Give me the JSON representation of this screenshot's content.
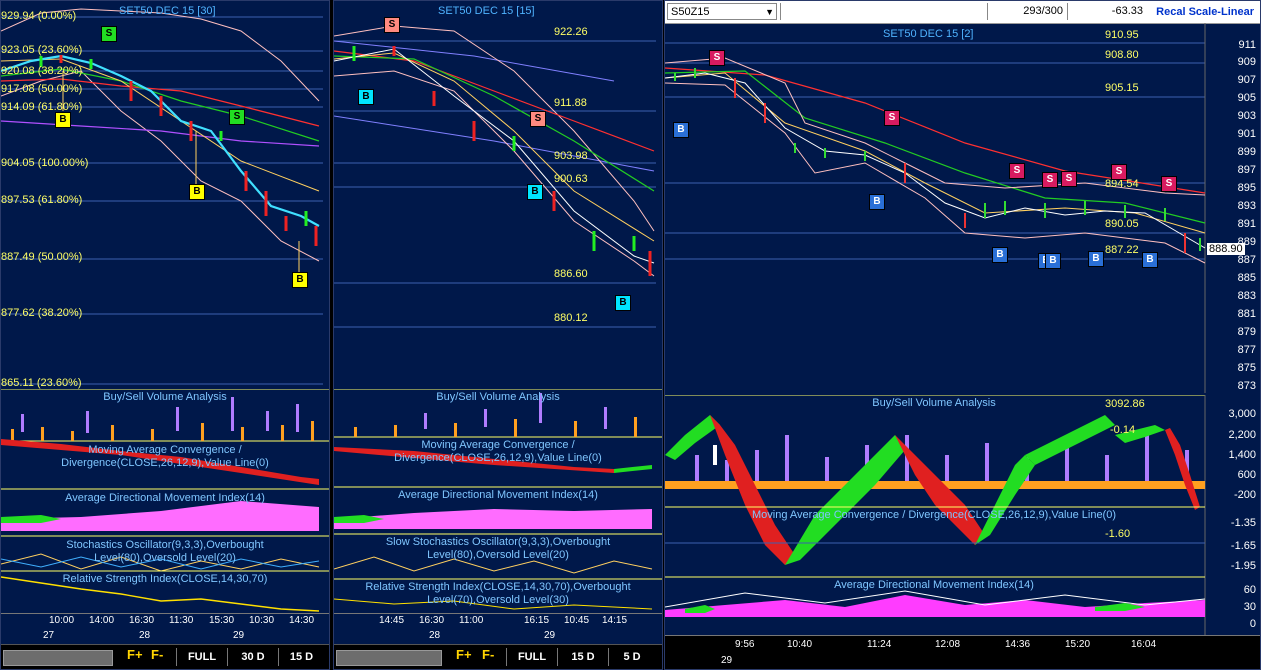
{
  "panel1": {
    "title": "SET50 DEC 15   [30]",
    "levels": [
      "929.94 (0.00%)",
      "923.05 (23.60%)",
      "920.08 (38.20%)",
      "917.08 (50.00%)",
      "914.09 (61.80%)",
      "904.05 (100.00%)",
      "897.53 (61.80%)",
      "887.49 (50.00%)",
      "877.62 (38.20%)",
      "865.11 (23.60%)"
    ],
    "indicators": [
      "Buy/Sell Volume Analysis",
      "Moving Average Convergence / Divergence(CLOSE,26,12,9),Value Line(0)",
      "Average Directional Movement Index(14)",
      "Stochastics Oscillator(9,3,3),Overbought Level(80),Oversold Level(20)",
      "Relative Strength Index(CLOSE,14,30,70)"
    ],
    "times": [
      "10:00",
      "14:00",
      "16:30",
      "11:30",
      "15:30",
      "10:30",
      "14:30"
    ],
    "dates": [
      "27",
      "28",
      "29"
    ],
    "buttons": [
      "FULL",
      "30 D",
      "15 D"
    ]
  },
  "panel2": {
    "title": "SET50 DEC 15   [15]",
    "levels": [
      "922.26",
      "911.88",
      "903.98",
      "900.63",
      "886.60",
      "880.12"
    ],
    "indicators": [
      "Buy/Sell Volume Analysis",
      "Moving Average Convergence / Divergence(CLOSE,26,12,9),Value Line(0)",
      "Average Directional Movement Index(14)",
      "Slow Stochastics Oscillator(9,3,3),Overbought Level(80),Oversold Level(20)",
      "Relative Strength Index(CLOSE,14,30,70),Overbought Level(70),Oversold Level(30)"
    ],
    "times": [
      "14:45",
      "16:30",
      "11:00",
      "16:15",
      "10:45",
      "14:15"
    ],
    "dates": [
      "28",
      "29"
    ],
    "buttons": [
      "FULL",
      "15 D",
      "5 D"
    ]
  },
  "panel3": {
    "symbol": "S50Z15",
    "count": "293/300",
    "change": "-63.33",
    "recal": "Recal Scale-Linear",
    "title": "SET50 DEC 15   [2]",
    "levels": [
      "910.95",
      "908.80",
      "905.15",
      "894.54",
      "890.05",
      "887.22"
    ],
    "last_price": "888.90",
    "yaxis": [
      "911",
      "909",
      "907",
      "905",
      "903",
      "901",
      "899",
      "897",
      "895",
      "893",
      "891",
      "889",
      "887",
      "885",
      "883",
      "881",
      "879",
      "877",
      "875",
      "873"
    ],
    "vol_value": "3092.86",
    "vol_axis": [
      "3,000",
      "2,200",
      "1,400",
      "600",
      "-200"
    ],
    "macd_value": "-0.14",
    "macd_axis": [
      "-1.35",
      "-1.65",
      "-1.95"
    ],
    "macd_signal": "-1.60",
    "adx_axis": [
      "60",
      "30",
      "0"
    ],
    "indicators": [
      "Buy/Sell Volume Analysis",
      "Moving Average Convergence / Divergence(CLOSE,26,12,9),Value Line(0)",
      "Average Directional Movement Index(14)"
    ],
    "times": [
      "9:56",
      "10:40",
      "11:24",
      "12:08",
      "14:36",
      "15:20",
      "16:04"
    ],
    "dates": [
      "29"
    ]
  },
  "tools": [
    "F+",
    "F-"
  ],
  "colors": {
    "panel_bg": "#00184a",
    "buy_yellow": "#ffff00",
    "buy_cyan": "#00e5ff",
    "sell_green": "#22dd22",
    "sell_magenta": "#d81b60"
  }
}
